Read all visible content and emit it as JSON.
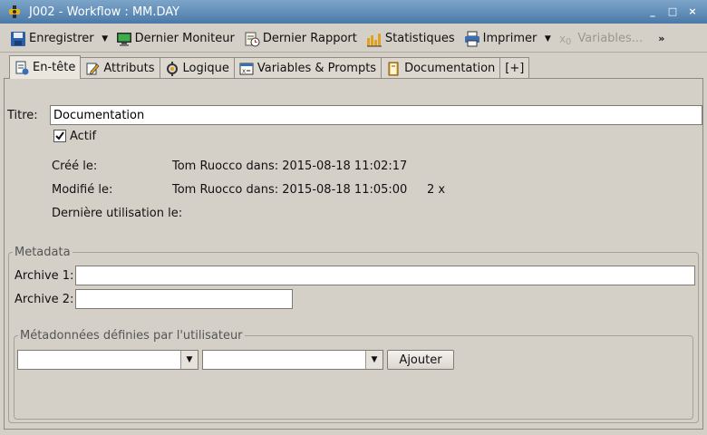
{
  "window": {
    "title": "J002 - Workflow : MM.DAY",
    "icon": "job-icon",
    "controls": [
      "_",
      "□",
      "×"
    ]
  },
  "toolbar": {
    "save_label": "Enregistrer",
    "monitor_label": "Dernier Moniteur",
    "report_label": "Dernier Rapport",
    "stats_label": "Statistiques",
    "print_label": "Imprimer",
    "variables_label": "Variables...",
    "more_label": "»"
  },
  "tabs": [
    {
      "label": "En-tête",
      "active": true
    },
    {
      "label": "Attributs"
    },
    {
      "label": "Logique"
    },
    {
      "label": "Variables & Prompts"
    },
    {
      "label": "Documentation"
    },
    {
      "label": "[+]"
    }
  ],
  "header": {
    "title_label": "Titre:",
    "title_value": "Documentation",
    "active_label": "Actif",
    "active_checked": true,
    "created_label": "Créé le:",
    "created_value": "Tom Ruocco dans: 2015-08-18 11:02:17",
    "modified_label": "Modifié le:",
    "modified_value": "Tom Ruocco dans: 2015-08-18 11:05:00",
    "modified_count": "2 x",
    "last_used_label": "Dernière utilisation le:"
  },
  "metadata": {
    "legend": "Metadata",
    "archive1_label": "Archive 1:",
    "archive1_value": "",
    "archive2_label": "Archive 2:",
    "archive2_value": "",
    "user_defined": {
      "legend": "Métadonnées définies par l'utilisateur",
      "combo1_value": "",
      "combo2_value": "",
      "add_label": "Ajouter"
    }
  },
  "colors": {
    "titlebar": "#5a86b3",
    "background": "#d4d0c8"
  }
}
